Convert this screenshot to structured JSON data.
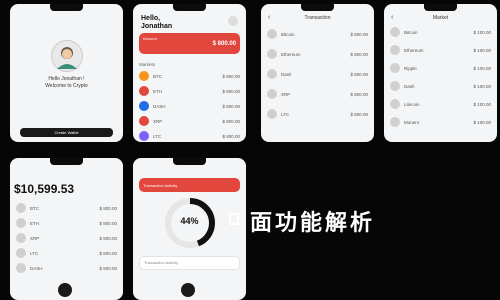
{
  "colors": {
    "bg": "#060606",
    "screen": "#f4f5f6",
    "red": "#e2473e",
    "dark": "#1a1a1a"
  },
  "screen1": {
    "greeting_line1": "Hello Jonathan !",
    "greeting_line2": "Welcome to Crypto",
    "button": "Create Wallet"
  },
  "screen2": {
    "title_line1": "Hello,",
    "title_line2": "Jonathan",
    "card_label": "Balance",
    "card_value": "$ 800.00",
    "section": "Markets",
    "rows": [
      {
        "icon": "bitcoin-icon",
        "name": "BTC",
        "value": "$ 800.00",
        "color": "#f7931a"
      },
      {
        "icon": "ethereum-icon",
        "name": "ETH",
        "value": "$ 800.00",
        "color": "#e2473e"
      },
      {
        "icon": "dash-icon",
        "name": "DASH",
        "value": "$ 800.00",
        "color": "#1f6fe5"
      },
      {
        "icon": "ripple-icon",
        "name": "XRP",
        "value": "$ 800.00",
        "color": "#e2473e"
      },
      {
        "icon": "litecoin-icon",
        "name": "LTC",
        "value": "$ 800.00",
        "color": "#7b61ff"
      }
    ]
  },
  "screen3": {
    "title": "Transaction",
    "rows": [
      {
        "name": "Bitcoin",
        "value": "$ 800.00"
      },
      {
        "name": "Ethereum",
        "value": "$ 800.00"
      },
      {
        "name": "Dash",
        "value": "$ 800.00"
      },
      {
        "name": "XRP",
        "value": "$ 800.00"
      },
      {
        "name": "LTC",
        "value": "$ 800.00"
      }
    ]
  },
  "screen4": {
    "title": "Market",
    "rows": [
      {
        "name": "Bitcoin",
        "value": "$ 100.00"
      },
      {
        "name": "Ethereum",
        "value": "$ 100.00"
      },
      {
        "name": "Ripple",
        "value": "$ 100.00"
      },
      {
        "name": "Dash",
        "value": "$ 100.00"
      },
      {
        "name": "Litecoin",
        "value": "$ 100.00"
      },
      {
        "name": "Monero",
        "value": "$ 100.00"
      }
    ]
  },
  "screen5": {
    "balance": "$10,599.53",
    "rows": [
      {
        "name": "BTC",
        "value": "$ 800.00"
      },
      {
        "name": "ETH",
        "value": "$ 800.00"
      },
      {
        "name": "XRP",
        "value": "$ 800.00"
      },
      {
        "name": "LTC",
        "value": "$ 800.00"
      },
      {
        "name": "DASH",
        "value": "$ 800.00"
      }
    ]
  },
  "screen6": {
    "card1": "Transaction Activity",
    "gauge_value": "44%",
    "gauge_fraction": 0.44,
    "card2": "Transaction Activity"
  },
  "caption": "面功能解析"
}
